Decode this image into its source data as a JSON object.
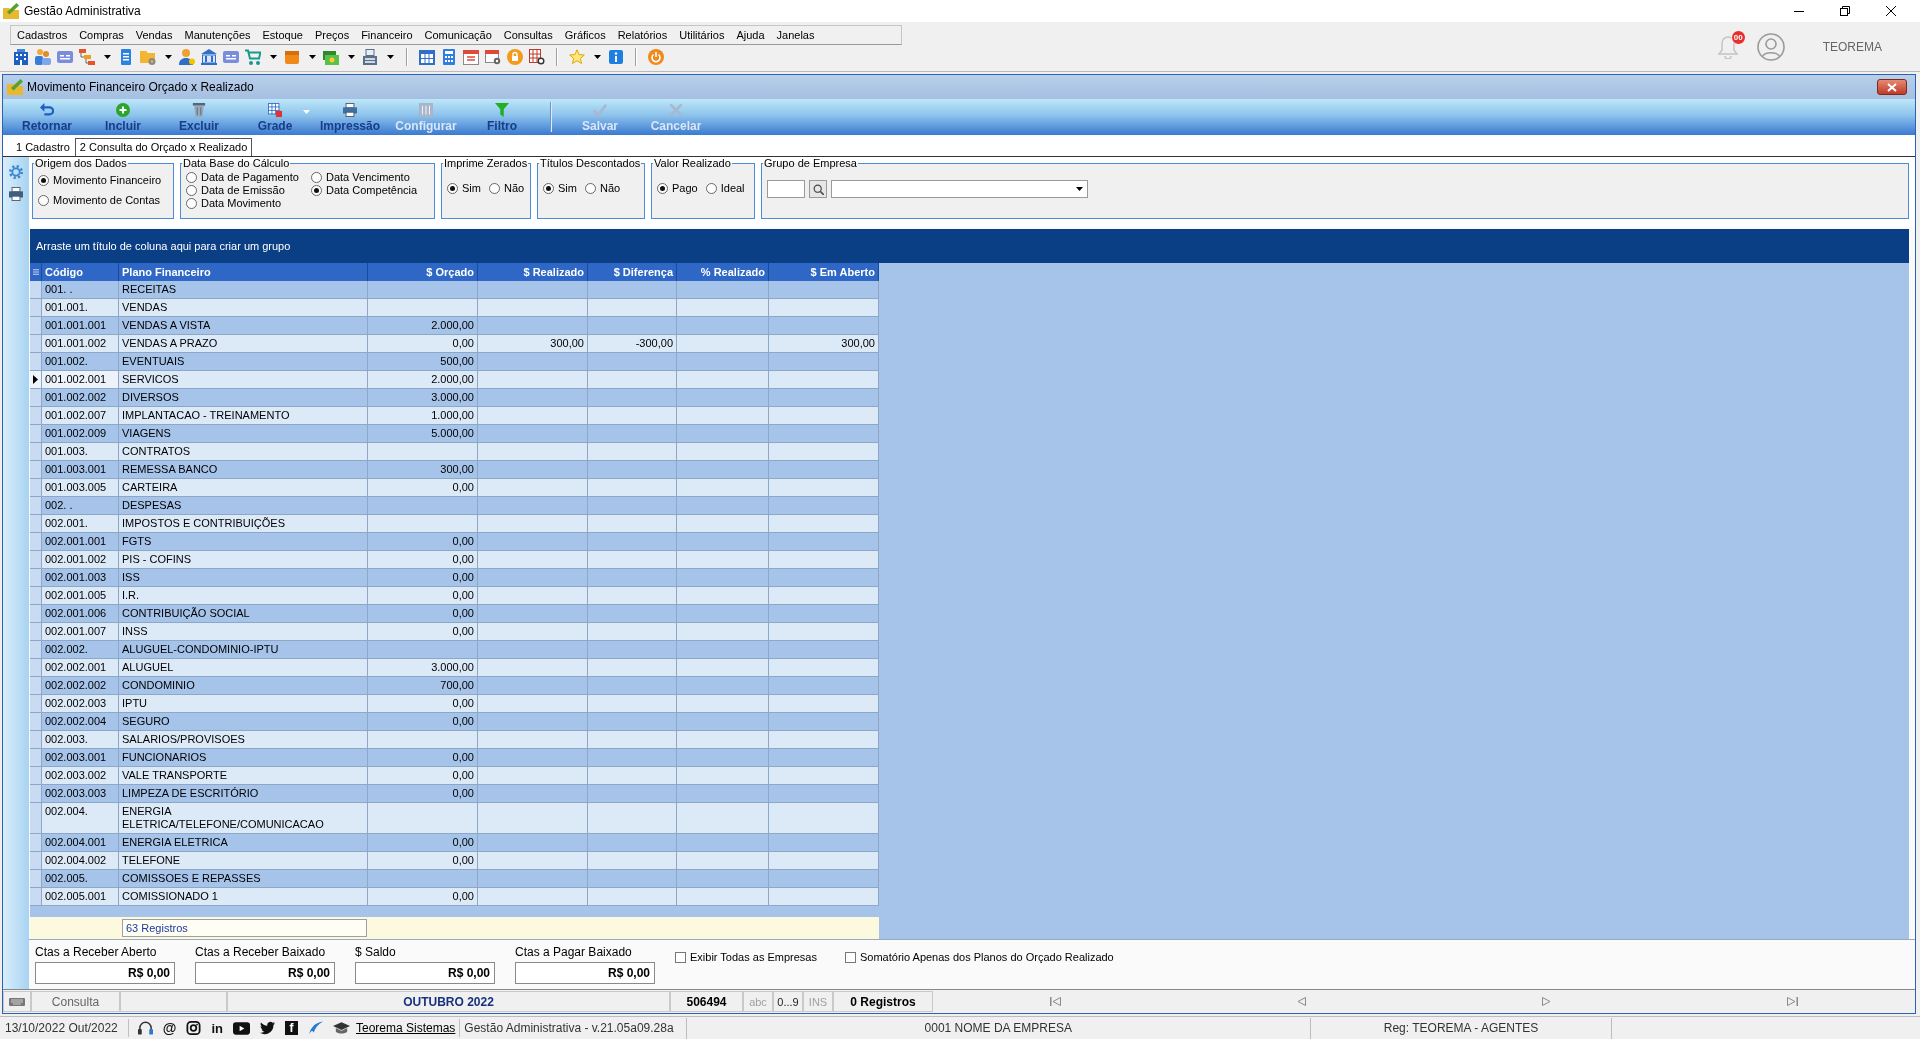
{
  "window": {
    "title": "Gestão Administrativa"
  },
  "menu": [
    "Cadastros",
    "Compras",
    "Vendas",
    "Manutenções",
    "Estoque",
    "Preços",
    "Financeiro",
    "Comunicação",
    "Consultas",
    "Gráficos",
    "Relatórios",
    "Utilitários",
    "Ajuda",
    "Janelas"
  ],
  "user": {
    "badge": "00",
    "name": "TEOREMA"
  },
  "document": {
    "title": "Movimento Financeiro Orçado x Realizado",
    "toolbar": [
      {
        "label": "Retornar",
        "kind": "button",
        "disabled": false
      },
      {
        "label": "Incluir",
        "kind": "button",
        "disabled": false
      },
      {
        "label": "Excluir",
        "kind": "button",
        "disabled": false
      },
      {
        "label": "Grade",
        "kind": "split",
        "disabled": false
      },
      {
        "label": "Impressão",
        "kind": "button",
        "disabled": false
      },
      {
        "label": "Configurar",
        "kind": "button",
        "disabled": true
      },
      {
        "label": "Filtro",
        "kind": "button",
        "disabled": false
      },
      {
        "label": "Salvar",
        "kind": "button",
        "disabled": true
      },
      {
        "label": "Cancelar",
        "kind": "button",
        "disabled": true
      }
    ],
    "tabs": [
      {
        "label": "1 Cadastro",
        "selected": false
      },
      {
        "label": "2 Consulta do Orçado x Realizado",
        "selected": true
      }
    ]
  },
  "filters": [
    {
      "kind": "radio-column",
      "title": "Origem dos Dados",
      "options": [
        {
          "label": "Movimento Financeiro",
          "selected": true
        },
        {
          "label": "Movimento de Contas",
          "selected": false
        }
      ]
    },
    {
      "kind": "radio-grid",
      "title": "Data Base do Cálculo",
      "options": [
        {
          "label": "Data de Pagamento",
          "selected": false
        },
        {
          "label": "Data Vencimento",
          "selected": false
        },
        {
          "label": "Data de Emissão",
          "selected": false
        },
        {
          "label": "Data Competência",
          "selected": true
        },
        {
          "label": "Data Movimento",
          "selected": false
        }
      ]
    },
    {
      "kind": "radio-row",
      "title": "Imprime Zerados",
      "options": [
        {
          "label": "Sim",
          "selected": true
        },
        {
          "label": "Não",
          "selected": false
        }
      ]
    },
    {
      "kind": "radio-row",
      "title": "Títulos Descontados",
      "options": [
        {
          "label": "Sim",
          "selected": true
        },
        {
          "label": "Não",
          "selected": false
        }
      ]
    },
    {
      "kind": "radio-row",
      "title": "Valor Realizado",
      "options": [
        {
          "label": "Pago",
          "selected": true
        },
        {
          "label": "Ideal",
          "selected": false
        }
      ]
    },
    {
      "kind": "company",
      "title": "Grupo de Empresa"
    }
  ],
  "grid": {
    "group_hint": "Arraste um título de coluna aqui para criar um grupo",
    "columns": [
      "Código",
      "Plano Financeiro",
      "$ Orçado",
      "$ Realizado",
      "$ Diferença",
      "% Realizado",
      "$ Em Aberto"
    ],
    "rows": [
      {
        "code": "001. .",
        "account": "RECEITAS",
        "selected": false
      },
      {
        "code": "001.001.",
        "account": "VENDAS",
        "selected": false
      },
      {
        "code": "001.001.001",
        "account": "VENDAS A VISTA",
        "budgeted": "2.000,00",
        "selected": false
      },
      {
        "code": "001.001.002",
        "account": "VENDAS A PRAZO",
        "budgeted": "0,00",
        "realized": "300,00",
        "difference": "-300,00",
        "open": "300,00",
        "selected": false
      },
      {
        "code": "001.002.",
        "account": "EVENTUAIS",
        "budgeted": "500,00",
        "selected": false
      },
      {
        "code": "001.002.001",
        "account": "SERVICOS",
        "budgeted": "2.000,00",
        "selected": true
      },
      {
        "code": "001.002.002",
        "account": "DIVERSOS",
        "budgeted": "3.000,00",
        "selected": false
      },
      {
        "code": "001.002.007",
        "account": "IMPLANTACAO - TREINAMENTO",
        "budgeted": "1.000,00",
        "selected": false
      },
      {
        "code": "001.002.009",
        "account": "VIAGENS",
        "budgeted": "5.000,00",
        "selected": false
      },
      {
        "code": "001.003.",
        "account": "CONTRATOS",
        "selected": false
      },
      {
        "code": "001.003.001",
        "account": "REMESSA BANCO",
        "budgeted": "300,00",
        "selected": false
      },
      {
        "code": "001.003.005",
        "account": "CARTEIRA",
        "budgeted": "0,00",
        "selected": false
      },
      {
        "code": "002. .",
        "account": "DESPESAS",
        "selected": false
      },
      {
        "code": "002.001.",
        "account": "IMPOSTOS E CONTRIBUIÇÕES",
        "selected": false
      },
      {
        "code": "002.001.001",
        "account": "FGTS",
        "budgeted": "0,00",
        "selected": false
      },
      {
        "code": "002.001.002",
        "account": "PIS - COFINS",
        "budgeted": "0,00",
        "selected": false
      },
      {
        "code": "002.001.003",
        "account": "ISS",
        "budgeted": "0,00",
        "selected": false
      },
      {
        "code": "002.001.005",
        "account": "I.R.",
        "budgeted": "0,00",
        "selected": false
      },
      {
        "code": "002.001.006",
        "account": "CONTRIBUIÇÃO SOCIAL",
        "budgeted": "0,00",
        "selected": false
      },
      {
        "code": "002.001.007",
        "account": "INSS",
        "budgeted": "0,00",
        "selected": false
      },
      {
        "code": "002.002.",
        "account": "ALUGUEL-CONDOMINIO-IPTU",
        "selected": false
      },
      {
        "code": "002.002.001",
        "account": "ALUGUEL",
        "budgeted": "3.000,00",
        "selected": false
      },
      {
        "code": "002.002.002",
        "account": "CONDOMINIO",
        "budgeted": "700,00",
        "selected": false
      },
      {
        "code": "002.002.003",
        "account": "IPTU",
        "budgeted": "0,00",
        "selected": false
      },
      {
        "code": "002.002.004",
        "account": "SEGURO",
        "budgeted": "0,00",
        "selected": false
      },
      {
        "code": "002.003.",
        "account": "SALARIOS/PROVISOES",
        "selected": false
      },
      {
        "code": "002.003.001",
        "account": "FUNCIONARIOS",
        "budgeted": "0,00",
        "selected": false
      },
      {
        "code": "002.003.002",
        "account": "VALE TRANSPORTE",
        "budgeted": "0,00",
        "selected": false
      },
      {
        "code": "002.003.003",
        "account": "LIMPEZA DE ESCRITÓRIO",
        "budgeted": "0,00",
        "selected": false
      },
      {
        "code": "002.004.",
        "account": "ENERGIA ELETRICA/TELEFONE/COMUNICACAO",
        "selected": false
      },
      {
        "code": "002.004.001",
        "account": "ENERGIA ELETRICA",
        "budgeted": "0,00",
        "selected": false
      },
      {
        "code": "002.004.002",
        "account": "TELEFONE",
        "budgeted": "0,00",
        "selected": false
      },
      {
        "code": "002.005.",
        "account": "COMISSOES E REPASSES",
        "selected": false
      },
      {
        "code": "002.005.001",
        "account": "COMISSIONADO 1",
        "budgeted": "0,00",
        "selected": false
      }
    ],
    "footer": "63 Registros"
  },
  "totals": [
    {
      "label": "Ctas a Receber Aberto",
      "value": "R$ 0,00"
    },
    {
      "label": "Ctas a Receber Baixado",
      "value": "R$ 0,00"
    },
    {
      "label": "$ Saldo",
      "value": "R$ 0,00"
    },
    {
      "label": "Ctas a Pagar Baixado",
      "value": "R$ 0,00"
    }
  ],
  "options": [
    {
      "label": "Exibir Todas as Empresas",
      "checked": false
    },
    {
      "label": "Somatório Apenas dos Planos do Orçado Realizado",
      "checked": false
    }
  ],
  "navigator": {
    "mode": "Consulta",
    "period": "OUTUBRO 2022",
    "code": "506494",
    "indicators": [
      {
        "label": "abc",
        "on": false
      },
      {
        "label": "0...9",
        "on": true
      },
      {
        "label": "INS",
        "on": false
      }
    ],
    "records": "0 Registros"
  },
  "status_bar": {
    "date": "13/10/2022 Out/2022",
    "glyphs": [
      "@",
      "in",
      "f"
    ],
    "link": "Teorema Sistemas",
    "version": "Gestão Administrativa - v.21.05a09.28a",
    "company": "0001 NOME DA EMPRESA",
    "registration": "Reg: TEOREMA - AGENTES"
  }
}
